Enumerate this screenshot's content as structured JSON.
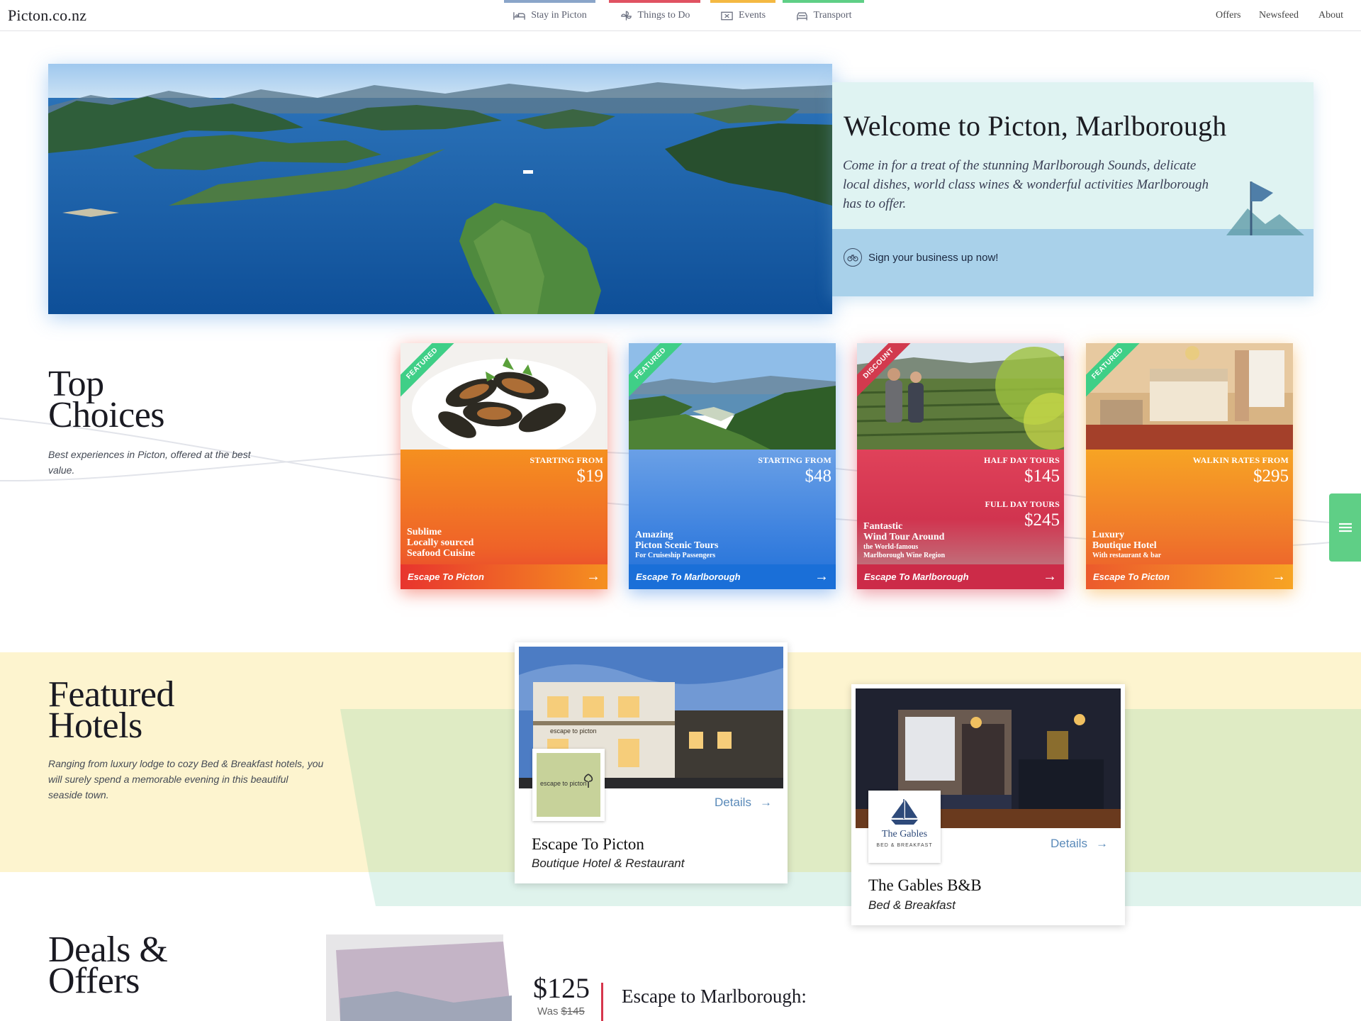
{
  "header": {
    "logo": "Picton.co.nz",
    "nav": [
      {
        "label": "Stay in Picton",
        "color": "#8aa5c9",
        "icon": "bed-icon"
      },
      {
        "label": "Things to Do",
        "color": "#e05262",
        "icon": "fan-icon"
      },
      {
        "label": "Events",
        "color": "#f4b942",
        "icon": "ticket-icon"
      },
      {
        "label": "Transport",
        "color": "#5fcf86",
        "icon": "car-icon"
      }
    ],
    "utility": [
      "Offers",
      "Newsfeed",
      "About"
    ]
  },
  "hero": {
    "title": "Welcome to Picton, Marlborough",
    "text": "Come in for a treat of the stunning Marlborough Sounds, delicate local dishes, world class wines & wonderful activities Marlborough has to offer.",
    "cta": "Sign your business up now!"
  },
  "top_choices": {
    "title_line1": "Top",
    "title_line2": "Choices",
    "subtitle": "Best experiences in Picton, offered at the best value.",
    "cards": [
      {
        "badge": "FEATURED",
        "price_label": "STARTING FROM",
        "price": "$19",
        "title": [
          "Sublime",
          "Locally sourced",
          "Seafood Cuisine"
        ],
        "small": "",
        "footer": "Escape To Picton",
        "color": "orange"
      },
      {
        "badge": "FEATURED",
        "price_label": "STARTING FROM",
        "price": "$48",
        "title": [
          "Amazing",
          "Picton Scenic Tours"
        ],
        "small": "For Cruiseship Passengers",
        "footer": "Escape To Marlborough",
        "color": "blue"
      },
      {
        "badge": "DISCOUNT",
        "price_label": "HALF DAY TOURS",
        "price": "$145",
        "price_label2": "FULL DAY TOURS",
        "price2": "$245",
        "title": [
          "Fantastic",
          "Wind Tour Around"
        ],
        "small": "the World-famous",
        "small2": "Marlborough Wine Region",
        "footer": "Escape To Marlborough",
        "color": "red"
      },
      {
        "badge": "FEATURED",
        "price_label": "WALKIN RATES FROM",
        "price": "$295",
        "title": [
          "Luxury",
          "Boutique Hotel"
        ],
        "small": "With restaurant & bar",
        "footer": "Escape To Picton",
        "color": "orange"
      }
    ]
  },
  "featured_hotels": {
    "title_line1": "Featured",
    "title_line2": "Hotels",
    "subtitle": "Ranging from luxury lodge to cozy Bed & Breakfast hotels, you will surely spend a memorable evening in this beautiful seaside town.",
    "hotels": [
      {
        "name": "Escape To Picton",
        "type": "Boutique Hotel & Restaurant",
        "details": "Details",
        "logo_text": "escape to picton",
        "sign_text": "escape to picton"
      },
      {
        "name": "The Gables B&B",
        "type": "Bed & Breakfast",
        "details": "Details",
        "logo_text": "The Gables",
        "logo_sub": "BED & BREAKFAST"
      }
    ]
  },
  "deals": {
    "title_line1": "Deals &",
    "title_line2": "Offers",
    "price": "$125",
    "was_label": "Was",
    "was_price": "$145",
    "headline": "Escape to Marlborough:"
  }
}
